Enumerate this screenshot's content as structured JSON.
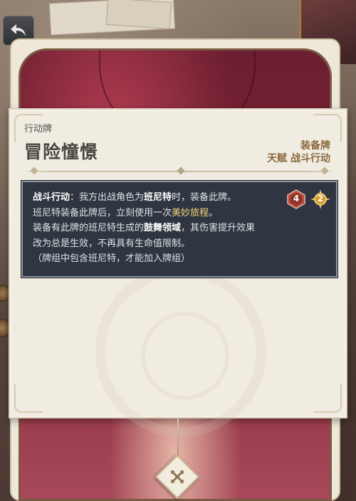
{
  "card": {
    "type_label": "行动牌",
    "name": "冒险憧憬",
    "tag_primary": "装备牌",
    "tag_secondary": "天赋  战斗行动"
  },
  "effect": {
    "line1": {
      "prefix": "战斗行动",
      "text_a": "：我方出战角色为",
      "character": "班尼特",
      "text_b": "时，装备此牌。"
    },
    "line2": {
      "text_a": "班尼特装备此牌后，立刻使用一次",
      "skill": "美妙旅程",
      "text_b": "。"
    },
    "line3": {
      "text_a": "装备有此牌的班尼特生成的",
      "field": "鼓舞领域",
      "text_b": "，其伤害提升效果"
    },
    "line4": "改为总是生效，不再具有生命值限制。",
    "line5": "（牌组中包含班尼特，才能加入牌组）"
  },
  "costs": {
    "element_dice": "4",
    "energy": "2"
  },
  "colors": {
    "panel_bg": "#f1ece2",
    "effect_bg": "#2f3641",
    "tag_color": "#8a6a3f",
    "highlight_gold": "#f2d27a",
    "pyro_die": "#b54a3c",
    "energy_die": "#d99a2b"
  },
  "icons": {
    "back": "back-arrow-icon",
    "close": "close-x-icon",
    "element_die": "pyro-die-icon",
    "energy": "energy-icon"
  }
}
